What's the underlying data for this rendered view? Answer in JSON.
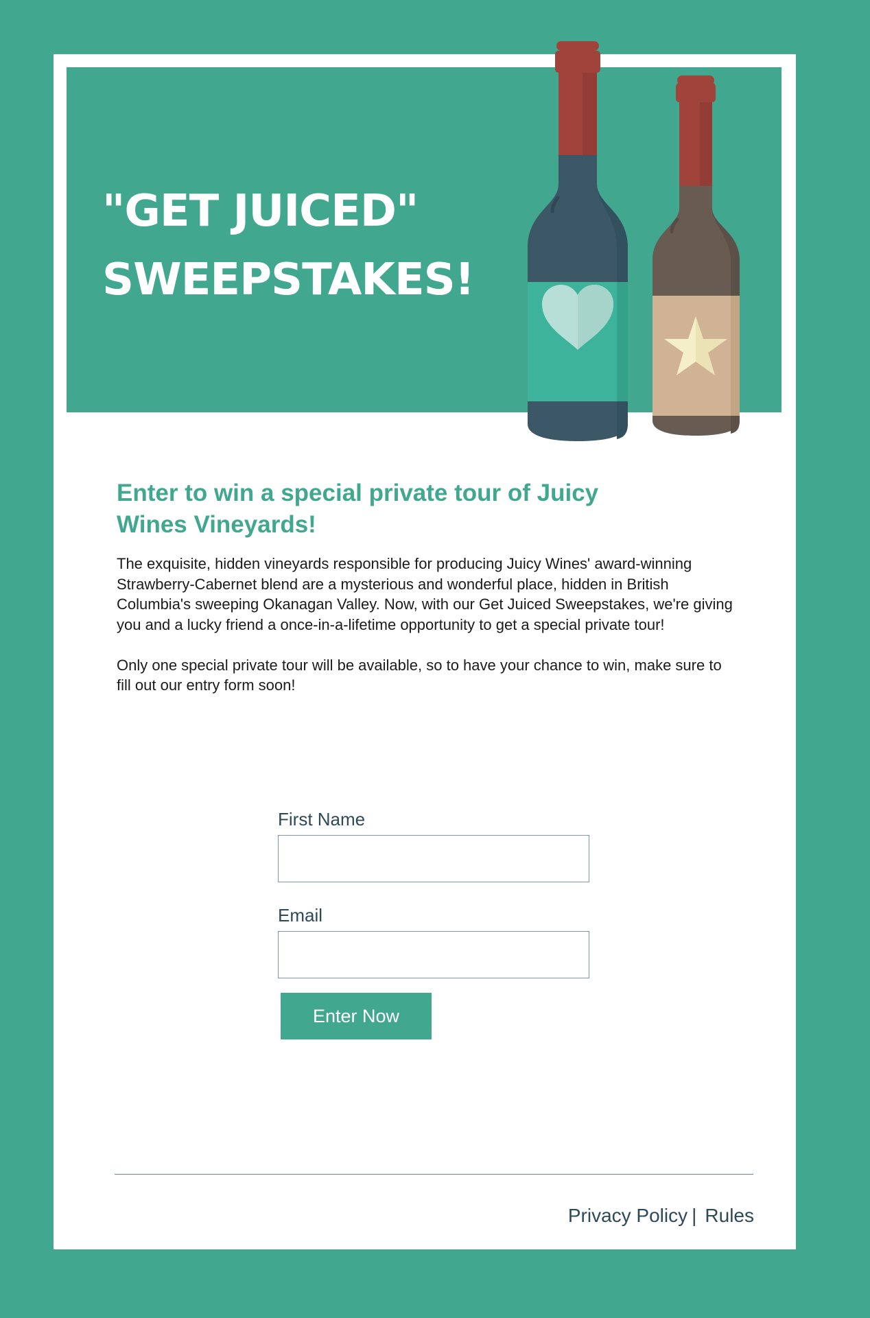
{
  "colors": {
    "background": "#41a78f",
    "card": "#ffffff",
    "accent": "#41a78f",
    "dark_text": "#2e4a59",
    "bottle_cap": "#a0433b",
    "bottle_blue": "#3c5867",
    "bottle_brown": "#675b52",
    "label_teal": "#3db39b",
    "label_tan": "#d0b394",
    "heart": "#b8dfd7",
    "star": "#f5efc9"
  },
  "hero": {
    "title_line1": "\"GET JUICED\"",
    "title_line2": "SWEEPSTAKES!",
    "illustration": {
      "bottles": [
        {
          "name": "wine-bottle-heart",
          "icon": "heart-icon"
        },
        {
          "name": "wine-bottle-star",
          "icon": "star-icon"
        }
      ]
    }
  },
  "intro": {
    "heading": "Enter to win a special private tour of Juicy Wines Vineyards!",
    "paragraph1": "The exquisite, hidden vineyards responsible for producing Juicy Wines' award-winning Strawberry-Cabernet blend are a mysterious and wonderful place, hidden in British Columbia's sweeping Okanagan Valley. Now, with our Get Juiced Sweepstakes, we're giving you and a lucky friend a once-in-a-lifetime opportunity to get a special private tour!",
    "paragraph2": "Only one special private tour will be available, so to have your chance to win, make sure to fill out our entry form soon!"
  },
  "form": {
    "first_name_label": "First Name",
    "first_name_value": "",
    "email_label": "Email",
    "email_value": "",
    "submit_label": "Enter Now"
  },
  "footer": {
    "privacy_label": "Privacy Policy",
    "separator": "|",
    "rules_label": "Rules"
  }
}
